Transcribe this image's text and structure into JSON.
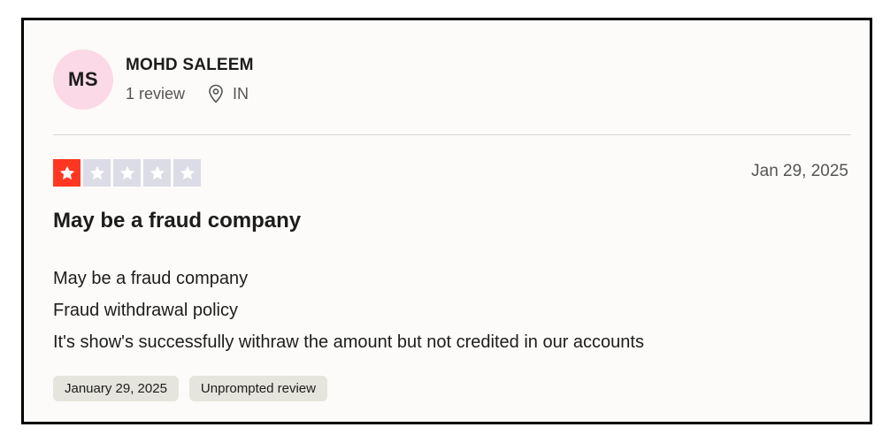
{
  "review": {
    "user": {
      "initials": "MS",
      "name": "MOHD SALEEM",
      "review_count": "1 review",
      "country": "IN"
    },
    "rating": 1,
    "rating_max": 5,
    "date": "Jan 29, 2025",
    "title": "May be a fraud company",
    "body_lines": [
      "May be a fraud company",
      "Fraud withdrawal policy",
      "It's show's successfully withraw the amount but not credited in our accounts"
    ],
    "tags": [
      "January 29, 2025",
      "Unprompted review"
    ]
  },
  "colors": {
    "star_on": "#ff3722",
    "star_off": "#dcdce6",
    "avatar_bg": "#fcd9e6"
  },
  "icons": {
    "location": "location-pin-icon",
    "star": "star-icon"
  }
}
